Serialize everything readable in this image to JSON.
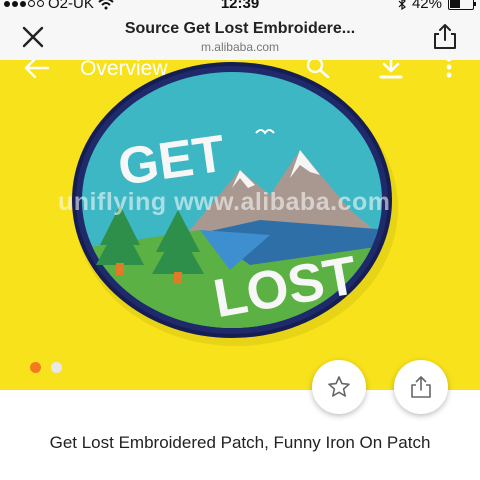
{
  "status_bar": {
    "carrier": "O2-UK",
    "time": "12:39",
    "battery": "42%",
    "battery_level": 0.42
  },
  "browser": {
    "title": "Source Get Lost Embroidere...",
    "url": "m.alibaba.com",
    "close_icon": "close-icon",
    "share_icon": "share-icon"
  },
  "gallery": {
    "nav_label": "Overview",
    "icons": [
      "back-arrow-icon",
      "search-icon",
      "download-icon",
      "more-vertical-icon"
    ],
    "watermark": "uniflying www.alibaba.com",
    "patch_text_top": "GET",
    "patch_text_bottom": "LOST",
    "background_color": "#f7e21b",
    "page_count": 2,
    "current_page": 1
  },
  "actions": {
    "favorite_icon": "star-icon",
    "share_icon": "share-icon"
  },
  "product": {
    "title": "Get Lost Embroidered Patch, Funny Iron On Patch"
  },
  "colors": {
    "accent": "#f47a20",
    "patch_border": "#1f2a6b",
    "sky": "#3eb7c4",
    "grass": "#5bb143"
  }
}
